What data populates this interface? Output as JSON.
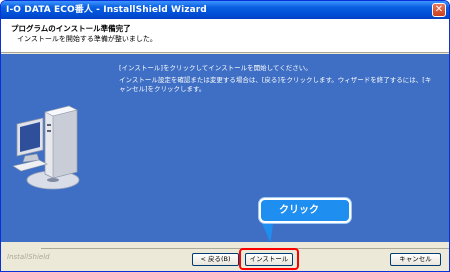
{
  "window": {
    "title": "I-O DATA ECO番人 - InstallShield Wizard",
    "close_glyph": "✕"
  },
  "header": {
    "title": "プログラムのインストール準備完了",
    "subtitle": "インストールを開始する準備が整いました。"
  },
  "content": {
    "line1": "[インストール]をクリックしてインストールを開始してください。",
    "line2": "インストール設定を確認または変更する場合は、[戻る]をクリックします。ウィザードを終了するには、[キャンセル]をクリックします。"
  },
  "footer": {
    "brand": "InstallShield",
    "back_label": "< 戻る(B)",
    "install_label": "インストール",
    "cancel_label": "キャンセル"
  },
  "annotation": {
    "callout_text": "クリック",
    "highlight_color": "#ff0000",
    "callout_color": "#1e8ef0"
  },
  "colors": {
    "panel_bg": "#3f6fc4",
    "titlebar": "#0050d8"
  }
}
